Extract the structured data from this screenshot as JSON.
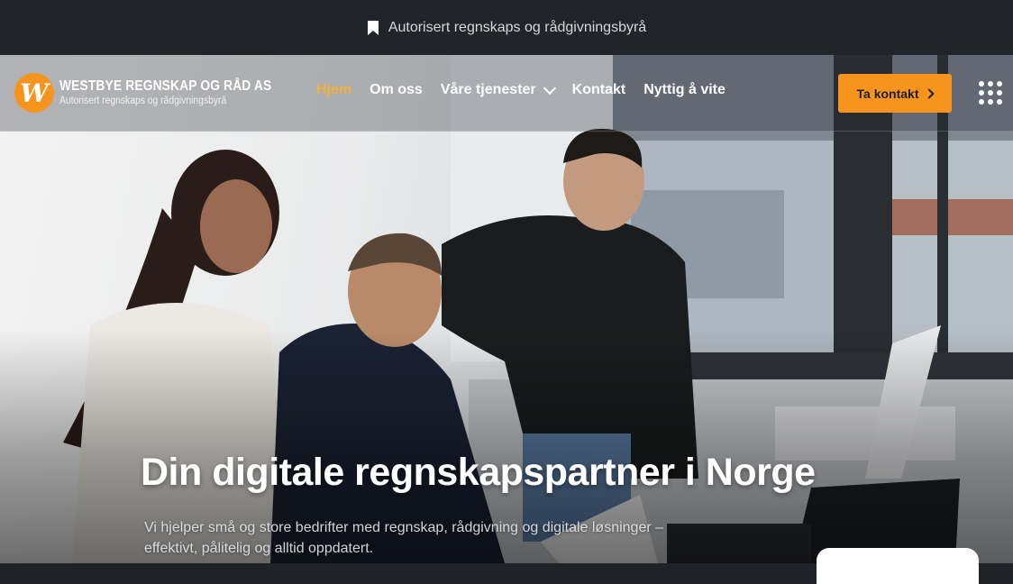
{
  "topbar": {
    "icon": "bookmark-icon",
    "text": "Autorisert regnskaps og rådgivningsbyrå"
  },
  "logo": {
    "mark": "W",
    "title": "WESTBYE REGNSKAP OG RÅD AS",
    "subtitle": "Autorisert regnskaps og rådgivningsbyrå"
  },
  "nav": {
    "items": [
      {
        "label": "Hjem",
        "active": true
      },
      {
        "label": "Om oss"
      },
      {
        "label": "Våre tjenester",
        "dropdown": true
      },
      {
        "label": "Kontakt"
      },
      {
        "label": "Nyttig å vite"
      }
    ],
    "cta_label": "Ta kontakt",
    "menu_icon": "grid-menu-icon"
  },
  "hero": {
    "headline": "Din digitale regnskapspartner i Norge",
    "lead": "Vi hjelper små og store bedrifter med regnskap, rådgivning og digitale løsninger – effektivt, pålitelig og alltid oppdatert."
  },
  "colors": {
    "accent": "#f7941d",
    "active_nav": "#f3b23f",
    "topbar_bg": "#212429"
  }
}
